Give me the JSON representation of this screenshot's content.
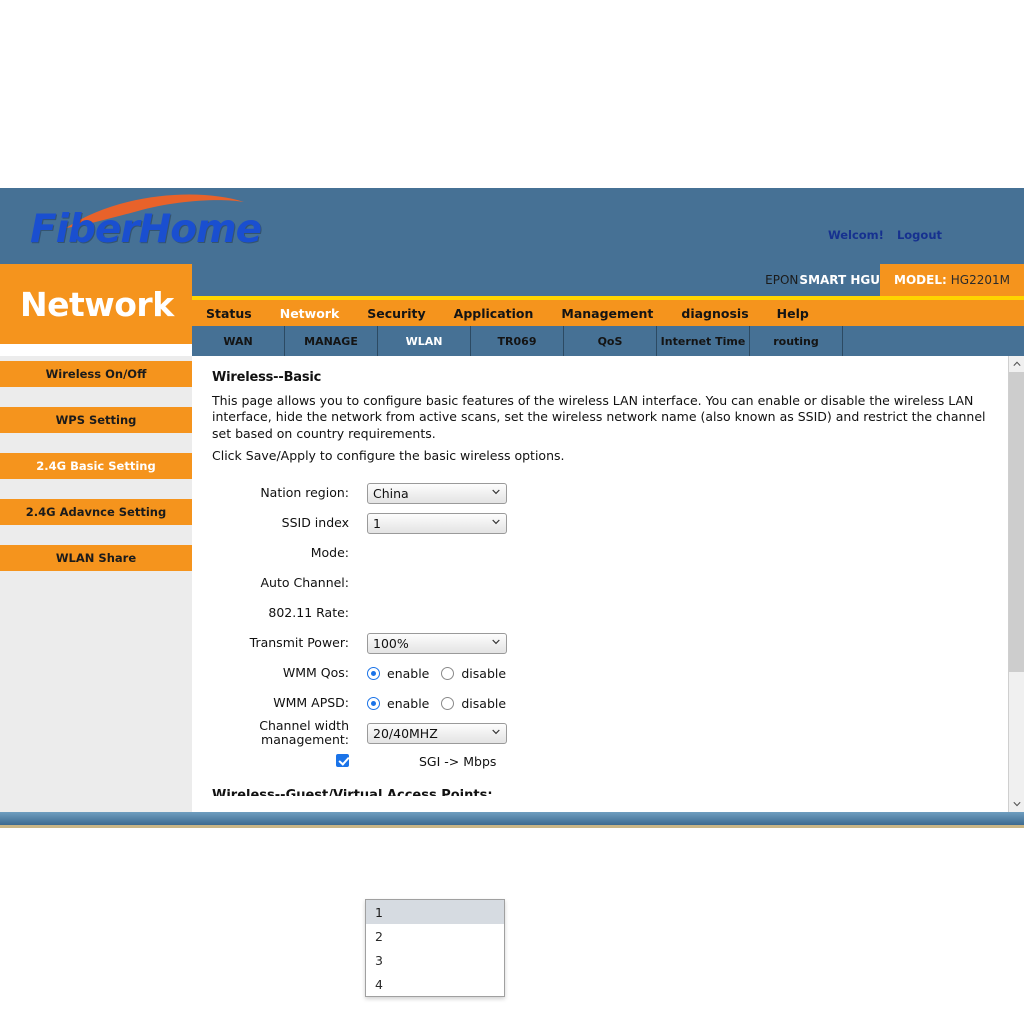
{
  "header": {
    "logo_text": "FiberHome",
    "logo_swoosh_icon": "swoosh-icon",
    "welcome_label": "Welcom!",
    "logout_label": "Logout",
    "brand_prefix": "EPON",
    "brand_suffix": "SMART HGU",
    "model_label": "MODEL:",
    "model_value": "HG2201M",
    "section_title": "Network"
  },
  "nav": {
    "items": [
      {
        "label": "Status",
        "active": false
      },
      {
        "label": "Network",
        "active": true
      },
      {
        "label": "Security",
        "active": false
      },
      {
        "label": "Application",
        "active": false
      },
      {
        "label": "Management",
        "active": false
      },
      {
        "label": "diagnosis",
        "active": false
      },
      {
        "label": "Help",
        "active": false
      }
    ]
  },
  "subnav": {
    "items": [
      {
        "label": "WAN",
        "active": false
      },
      {
        "label": "MANAGE",
        "active": false
      },
      {
        "label": "WLAN",
        "active": true
      },
      {
        "label": "TR069",
        "active": false
      },
      {
        "label": "QoS",
        "active": false
      },
      {
        "label": "Internet Time",
        "active": false
      },
      {
        "label": "routing",
        "active": false
      }
    ]
  },
  "sidebar": {
    "items": [
      {
        "label": "Wireless On/Off",
        "active": false
      },
      {
        "label": "WPS Setting",
        "active": false
      },
      {
        "label": "2.4G Basic Setting",
        "active": true
      },
      {
        "label": "2.4G Adavnce Setting",
        "active": false
      },
      {
        "label": "WLAN Share",
        "active": false
      }
    ]
  },
  "content": {
    "title": "Wireless--Basic",
    "paragraph1": "This page allows you to configure basic features of the wireless LAN interface. You can enable or disable the wireless LAN interface, hide the network from active scans, set the wireless network name (also known as SSID) and restrict the channel set based on country requirements.",
    "paragraph2": "Click Save/Apply to configure the basic wireless options.",
    "clipped_heading": "Wireless--Guest/Virtual Access Points:",
    "fields": {
      "nation_region_label": "Nation region:",
      "nation_region_value": "China",
      "ssid_index_label": "SSID index",
      "ssid_index_value": "1",
      "ssid_index_options": [
        "1",
        "2",
        "3",
        "4"
      ],
      "ssid_index_highlighted": "1",
      "mode_label": "Mode:",
      "auto_channel_label": "Auto Channel:",
      "rate_label": "802.11 Rate:",
      "transmit_power_label": "Transmit Power:",
      "transmit_power_value": "100%",
      "wmm_qos_label": "WMM Qos:",
      "wmm_apsd_label": "WMM APSD:",
      "enable_label": "enable",
      "disable_label": "disable",
      "wmm_qos_selected": "enable",
      "wmm_apsd_selected": "enable",
      "channel_width_label_line1": "Channel width",
      "channel_width_label_line2": "management:",
      "channel_width_value": "20/40MHZ",
      "sgi_label": "SGI -> Mbps",
      "sgi_checked": true
    }
  },
  "scrollbar": {
    "up_icon": "chevron-up-icon",
    "down_icon": "chevron-down-icon"
  },
  "colors": {
    "banner_blue": "#467195",
    "accent_orange": "#f5941d",
    "accent_yellow": "#ffd400",
    "link_blue": "#16318f",
    "control_blue": "#1a73e8",
    "footer_gold": "#c9b585"
  }
}
